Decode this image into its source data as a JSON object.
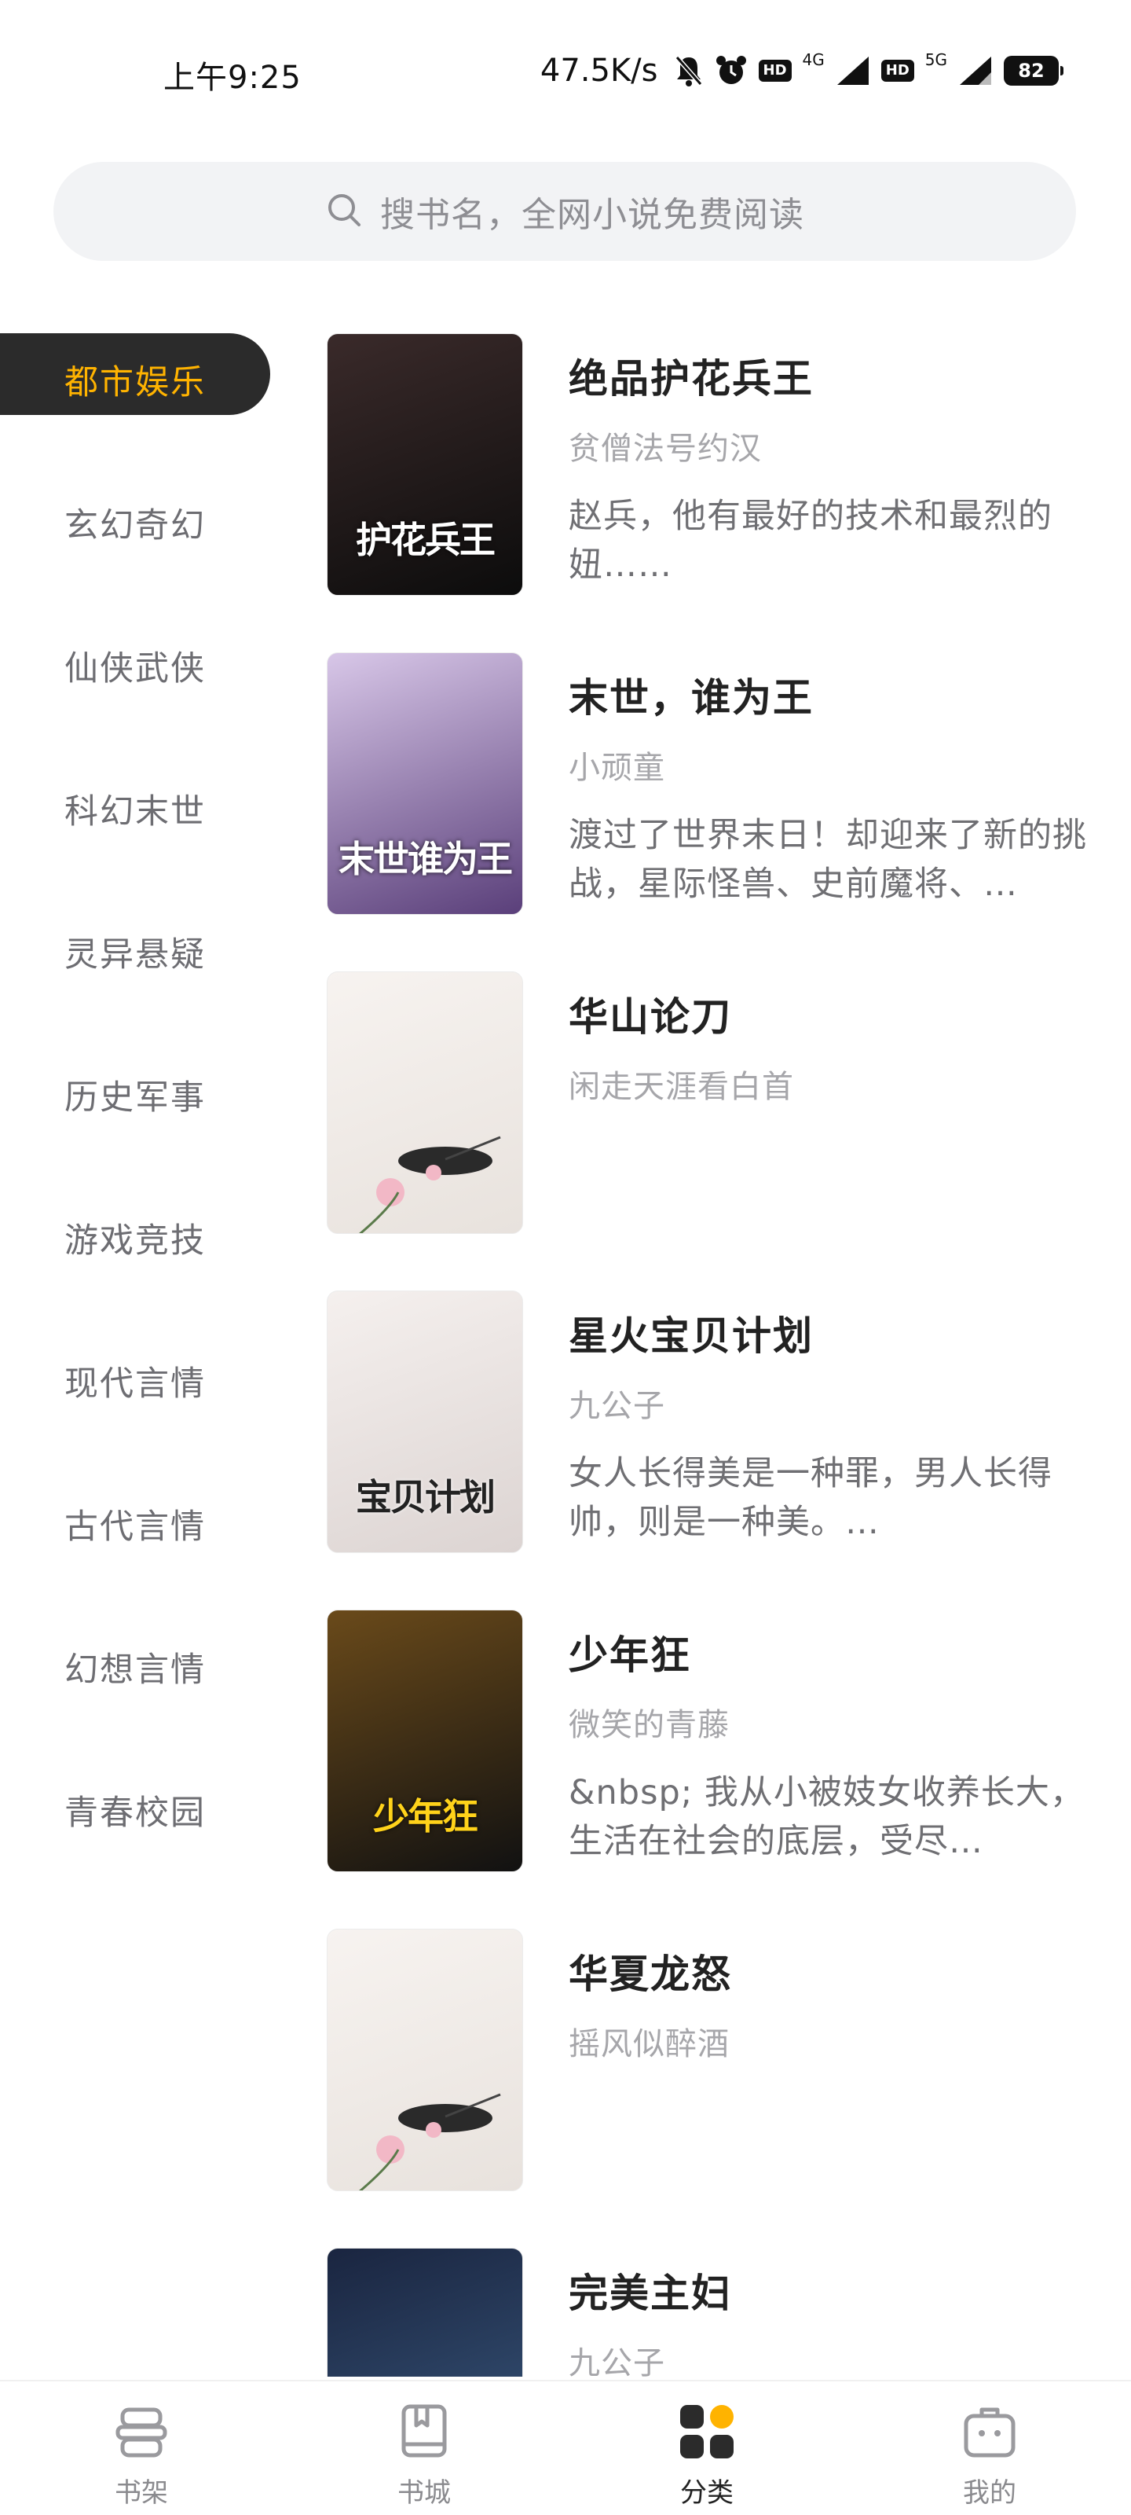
{
  "status_bar": {
    "time": "上午9:25",
    "net_speed": "47.5K/s",
    "hd1": "HD",
    "net1": "4G",
    "hd2": "HD",
    "net2": "5G",
    "battery": "82",
    "icons": [
      "bell-muted-icon",
      "alarm-icon",
      "signal-icon",
      "battery-icon"
    ]
  },
  "search": {
    "placeholder": "搜书名，全网小说免费阅读",
    "icon": "search-icon"
  },
  "sidebar": {
    "active_color": "#ffb300",
    "items": [
      {
        "label": "都市娱乐",
        "active": true
      },
      {
        "label": "玄幻奇幻"
      },
      {
        "label": "仙侠武侠"
      },
      {
        "label": "科幻末世"
      },
      {
        "label": "灵异悬疑"
      },
      {
        "label": "历史军事"
      },
      {
        "label": "游戏竞技"
      },
      {
        "label": "现代言情"
      },
      {
        "label": "古代言情"
      },
      {
        "label": "幻想言情"
      },
      {
        "label": "青春校园"
      }
    ]
  },
  "books": [
    {
      "title": "绝品护花兵王",
      "author": "贫僧法号约汉",
      "desc": "赵兵，他有最好的技术和最烈的妞……",
      "cover_text": "护花兵王",
      "cover_colors": [
        "#3a2a2a",
        "#0c0c0c"
      ]
    },
    {
      "title": "末世，谁为王",
      "author": "小顽童",
      "desc": "渡过了世界末日！却迎来了新的挑战，星际怪兽、史前魔将、…",
      "cover_text": "末世谁为王",
      "cover_colors": [
        "#d8c7e8",
        "#5a3f7a"
      ]
    },
    {
      "title": "华山论刀",
      "author": "闲走天涯看白首",
      "desc": "",
      "cover_text": "",
      "cover_colors": [
        "#f7f3f0",
        "#e8e2dd"
      ]
    },
    {
      "title": "星火宝贝计划",
      "author": "九公子",
      "desc": "女人长得美是一种罪，男人长得帅，则是一种美。…",
      "cover_text": "宝贝计划",
      "cover_colors": [
        "#f5f0ee",
        "#dcd4d2"
      ]
    },
    {
      "title": "少年狂",
      "author": "微笑的青藤",
      "desc": "&nbsp; 我从小被妓女收养长大，生活在社会的底层，受尽…",
      "cover_text": "少年狂",
      "cover_colors": [
        "#6a4a1a",
        "#111111"
      ]
    },
    {
      "title": "华夏龙怒",
      "author": "摇风似醉酒",
      "desc": "",
      "cover_text": "",
      "cover_colors": [
        "#f7f3f0",
        "#e8e2dd"
      ]
    },
    {
      "title": "完美主妇",
      "author": "九公子",
      "desc": "",
      "cover_text": "",
      "cover_colors": [
        "#1a2540",
        "#3a5a80"
      ]
    }
  ],
  "bottom_nav": {
    "items": [
      {
        "label": "书架",
        "icon": "bookshelf-icon"
      },
      {
        "label": "书城",
        "icon": "book-icon"
      },
      {
        "label": "分类",
        "icon": "category-icon",
        "active": true
      },
      {
        "label": "我的",
        "icon": "profile-bag-icon"
      }
    ]
  }
}
